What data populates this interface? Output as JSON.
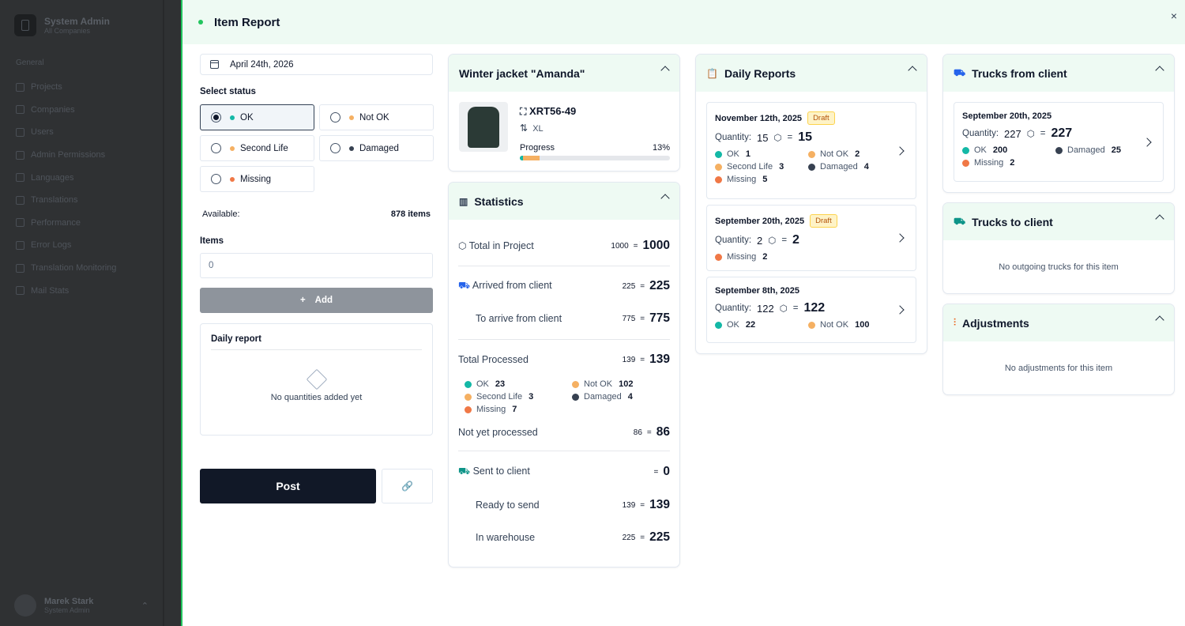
{
  "sidebar": {
    "title": "System Admin",
    "subtitle": "All Companies",
    "section": "General",
    "items": [
      "Projects",
      "Companies",
      "Users",
      "Admin Permissions",
      "Languages",
      "Translations",
      "Performance",
      "Error Logs",
      "Translation Monitoring",
      "Mail Stats"
    ],
    "user": {
      "name": "Marek Stark",
      "role": "System Admin"
    }
  },
  "modal": {
    "title": "Item Report",
    "close": "×"
  },
  "form": {
    "date": "April 24th, 2026",
    "select_status": "Select status",
    "statuses": [
      {
        "label": "OK",
        "color": "#14b8a6",
        "selected": true
      },
      {
        "label": "Not OK",
        "color": "#f5b062"
      },
      {
        "label": "Second Life",
        "color": "#f5b062"
      },
      {
        "label": "Damaged",
        "color": "#374151"
      },
      {
        "label": "Missing",
        "color": "#f07846"
      }
    ],
    "available_label": "Available:",
    "available_value": "878 items",
    "items_label": "Items",
    "items_value": "0",
    "add": "Add",
    "daily_report": "Daily report",
    "no_quantities": "No quantities added yet",
    "post": "Post"
  },
  "product": {
    "name": "Winter jacket \"Amanda\"",
    "sku": "XRT56-49",
    "size": "XL",
    "progress_label": "Progress",
    "progress_text": "13%",
    "progress": 0.13
  },
  "stats": {
    "title": "Statistics",
    "total": {
      "label": "Total in Project",
      "small": "1000",
      "eq": "=",
      "big": "1000"
    },
    "arrived": {
      "label": "Arrived from client",
      "small": "225",
      "eq": "=",
      "big": "225"
    },
    "to_arrive": {
      "label": "To arrive from client",
      "small": "775",
      "eq": "=",
      "big": "775"
    },
    "processed": {
      "label": "Total Processed",
      "small": "139",
      "eq": "=",
      "big": "139"
    },
    "breakdown": [
      {
        "label": "OK",
        "value": "23",
        "color": "#14b8a6"
      },
      {
        "label": "Not OK",
        "value": "102",
        "color": "#f5b062"
      },
      {
        "label": "Second Life",
        "value": "3",
        "color": "#f5b062"
      },
      {
        "label": "Damaged",
        "value": "4",
        "color": "#374151"
      },
      {
        "label": "Missing",
        "value": "7",
        "color": "#f07846"
      }
    ],
    "not_processed": {
      "label": "Not yet processed",
      "small": "86",
      "eq": "=",
      "big": "86"
    },
    "sent": {
      "label": "Sent to client",
      "small": "",
      "eq": "=",
      "big": "0"
    },
    "ready": {
      "label": "Ready to send",
      "small": "139",
      "eq": "=",
      "big": "139"
    },
    "warehouse": {
      "label": "In warehouse",
      "small": "225",
      "eq": "=",
      "big": "225"
    }
  },
  "daily_reports": {
    "title": "Daily Reports",
    "quantity_label": "Quantity:",
    "eq": "=",
    "reports": [
      {
        "date": "November 12th, 2025",
        "badge": "Draft",
        "qty": "15",
        "big": "15",
        "items": [
          {
            "label": "OK",
            "value": "1",
            "color": "#14b8a6"
          },
          {
            "label": "Not OK",
            "value": "2",
            "color": "#f5b062"
          },
          {
            "label": "Second Life",
            "value": "3",
            "color": "#f5b062"
          },
          {
            "label": "Damaged",
            "value": "4",
            "color": "#374151"
          },
          {
            "label": "Missing",
            "value": "5",
            "color": "#f07846"
          }
        ]
      },
      {
        "date": "September 20th, 2025",
        "badge": "Draft",
        "qty": "2",
        "big": "2",
        "items": [
          {
            "label": "Missing",
            "value": "2",
            "color": "#f07846"
          }
        ]
      },
      {
        "date": "September 8th, 2025",
        "badge": "",
        "qty": "122",
        "big": "122",
        "items": [
          {
            "label": "OK",
            "value": "22",
            "color": "#14b8a6"
          },
          {
            "label": "Not OK",
            "value": "100",
            "color": "#f5b062"
          }
        ]
      }
    ]
  },
  "trucks_from": {
    "title": "Trucks from client",
    "date": "September 20th, 2025",
    "quantity_label": "Quantity:",
    "qty": "227",
    "eq": "=",
    "big": "227",
    "items": [
      {
        "label": "OK",
        "value": "200",
        "color": "#14b8a6"
      },
      {
        "label": "Damaged",
        "value": "25",
        "color": "#374151"
      },
      {
        "label": "Missing",
        "value": "2",
        "color": "#f07846"
      }
    ]
  },
  "trucks_to": {
    "title": "Trucks to client",
    "empty": "No outgoing trucks for this item"
  },
  "adjustments": {
    "title": "Adjustments",
    "empty": "No adjustments for this item"
  }
}
